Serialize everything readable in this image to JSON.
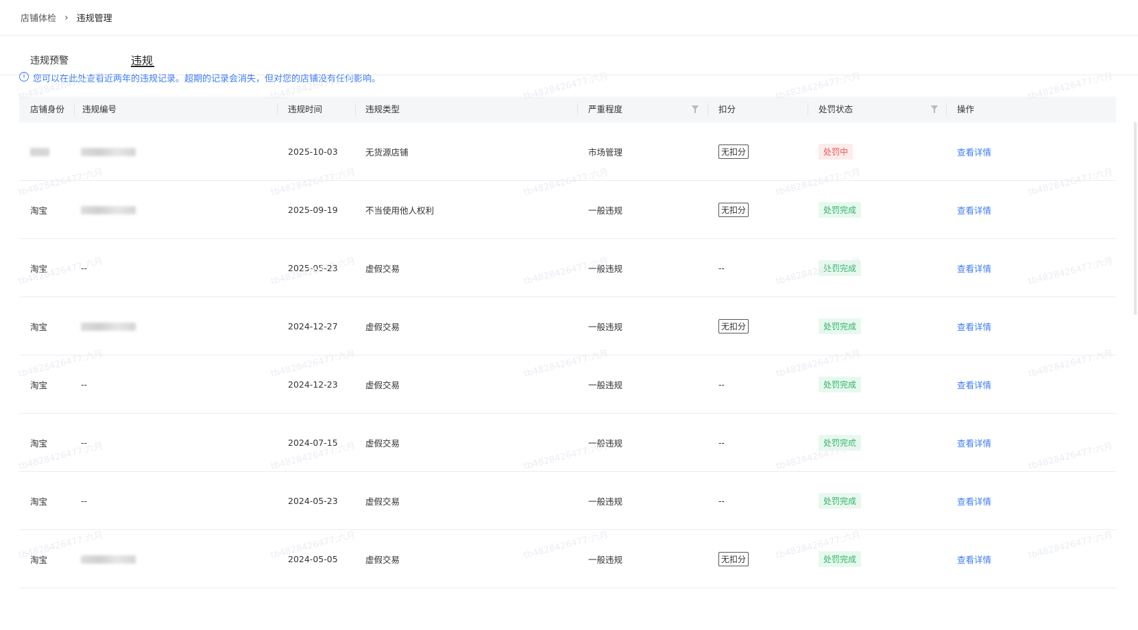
{
  "breadcrumb": {
    "parent": "店铺体检",
    "separator": "›",
    "current": "违规管理"
  },
  "tabs": [
    {
      "label": "违规预警"
    },
    {
      "label": "违规"
    }
  ],
  "notice": {
    "icon": "info-icon",
    "text": "您可以在此处查看近两年的违规记录。超期的记录会消失，但对您的店铺没有任何影响。"
  },
  "table": {
    "headers": [
      "店铺身份",
      "违规编号",
      "违规时间",
      "违规类型",
      "严重程度",
      "扣分",
      "处罚状态",
      "操作"
    ],
    "rows": [
      {
        "identity": "",
        "id": "",
        "time": "2025-10-03",
        "type": "无货源店铺",
        "severity": "市场管理",
        "score": "无扣分",
        "status": "处罚中",
        "action": "查看详情"
      },
      {
        "identity": "淘宝",
        "id": "",
        "time": "2025-09-19",
        "type": "不当使用他人权利",
        "severity": "一般违规",
        "score": "无扣分",
        "status": "处罚完成",
        "action": "查看详情"
      },
      {
        "identity": "淘宝",
        "id": "--",
        "time": "2025-05-23",
        "type": "虚假交易",
        "severity": "一般违规",
        "score": "--",
        "status": "处罚完成",
        "action": "查看详情"
      },
      {
        "identity": "淘宝",
        "id": "",
        "time": "2024-12-27",
        "type": "虚假交易",
        "severity": "一般违规",
        "score": "无扣分",
        "status": "处罚完成",
        "action": "查看详情"
      },
      {
        "identity": "淘宝",
        "id": "--",
        "time": "2024-12-23",
        "type": "虚假交易",
        "severity": "一般违规",
        "score": "--",
        "status": "处罚完成",
        "action": "查看详情"
      },
      {
        "identity": "淘宝",
        "id": "--",
        "time": "2024-07-15",
        "type": "虚假交易",
        "severity": "一般违规",
        "score": "--",
        "status": "处罚完成",
        "action": "查看详情"
      },
      {
        "identity": "淘宝",
        "id": "--",
        "time": "2024-05-23",
        "type": "虚假交易",
        "severity": "一般违规",
        "score": "--",
        "status": "处罚完成",
        "action": "查看详情"
      },
      {
        "identity": "淘宝",
        "id": "",
        "time": "2024-05-05",
        "type": "虚假交易",
        "severity": "一般违规",
        "score": "无扣分",
        "status": "处罚完成",
        "action": "查看详情"
      }
    ]
  },
  "colors": {
    "link": "#3d7bf7",
    "status_red": "#f0544f",
    "status_green": "#2fb36a"
  },
  "watermark": "tb4828426477:六月"
}
